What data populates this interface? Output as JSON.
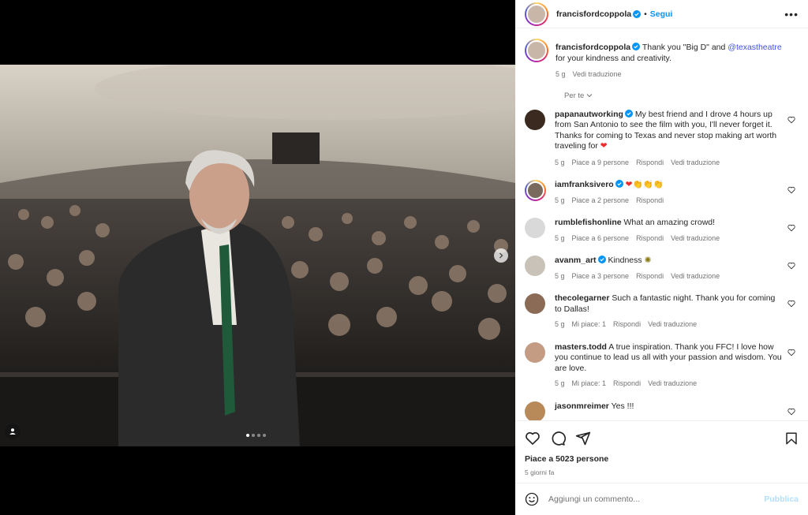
{
  "post": {
    "author": "francisfordcoppola",
    "follow_label": "Segui",
    "more_label": "•••",
    "separator": "•"
  },
  "caption": {
    "author": "francisfordcoppola",
    "text_before": " Thank you \"Big D\" and ",
    "mention": "@texastheatre",
    "text_after": " for your kindness and creativity.",
    "time": "5 g",
    "translate": "Vedi traduzione"
  },
  "sort_label": "Per te",
  "comments": [
    {
      "user": "papanautworking",
      "verified": true,
      "text": " My best friend and I drove 4 hours up from San Antonio to see the film with you, I'll never forget it. Thanks for coming to Texas and never stop making art worth traveling for ",
      "emoji": "❤",
      "time": "5 g",
      "likes": "Piace a 9 persone",
      "reply": "Rispondi",
      "translate": "Vedi traduzione"
    },
    {
      "user": "iamfranksivero",
      "verified": true,
      "text": " ",
      "emoji": "❤👏👏👏",
      "time": "5 g",
      "likes": "Piace a 2 persone",
      "reply": "Rispondi",
      "translate": ""
    },
    {
      "user": "rumblefishonline",
      "verified": false,
      "text": " What an amazing crowd!",
      "emoji": "",
      "time": "5 g",
      "likes": "Piace a 6 persone",
      "reply": "Rispondi",
      "translate": "Vedi traduzione"
    },
    {
      "user": "avanm_art",
      "verified": true,
      "text": " Kindness ",
      "emoji": "✺",
      "time": "5 g",
      "likes": "Piace a 3 persone",
      "reply": "Rispondi",
      "translate": "Vedi traduzione"
    },
    {
      "user": "thecolegarner",
      "verified": false,
      "text": " Such a fantastic night. Thank you for coming to Dallas!",
      "emoji": "",
      "time": "5 g",
      "likes": "Mi piace: 1",
      "reply": "Rispondi",
      "translate": "Vedi traduzione"
    },
    {
      "user": "masters.todd",
      "verified": false,
      "text": " A true inspiration. Thank you FFC! I love how you continue to lead us all with your passion and wisdom. You are love.",
      "emoji": "",
      "time": "5 g",
      "likes": "Mi piace: 1",
      "reply": "Rispondi",
      "translate": "Vedi traduzione"
    },
    {
      "user": "jasonmreimer",
      "verified": false,
      "text": " Yes !!!",
      "emoji": "",
      "time": "",
      "likes": "",
      "reply": "",
      "translate": ""
    }
  ],
  "footer": {
    "likes": "Piace a 5023 persone",
    "ago": "5 giorni fa",
    "comment_placeholder": "Aggiungi un commento...",
    "publish_label": "Pubblica"
  },
  "carousel": {
    "count": 4,
    "active": 0
  },
  "icons": {
    "verified": "verified-badge-icon",
    "heart": "heart-icon",
    "comment": "comment-icon",
    "share": "share-icon",
    "save": "bookmark-icon",
    "emoji": "emoji-icon",
    "next": "chevron-right-icon",
    "tag": "user-tag-icon"
  },
  "colors": {
    "accent": "#0095f6",
    "mention": "#4150f7",
    "meta": "#737373",
    "publish_disabled": "#b2dffc",
    "heart_red": "#ed2b2b"
  }
}
